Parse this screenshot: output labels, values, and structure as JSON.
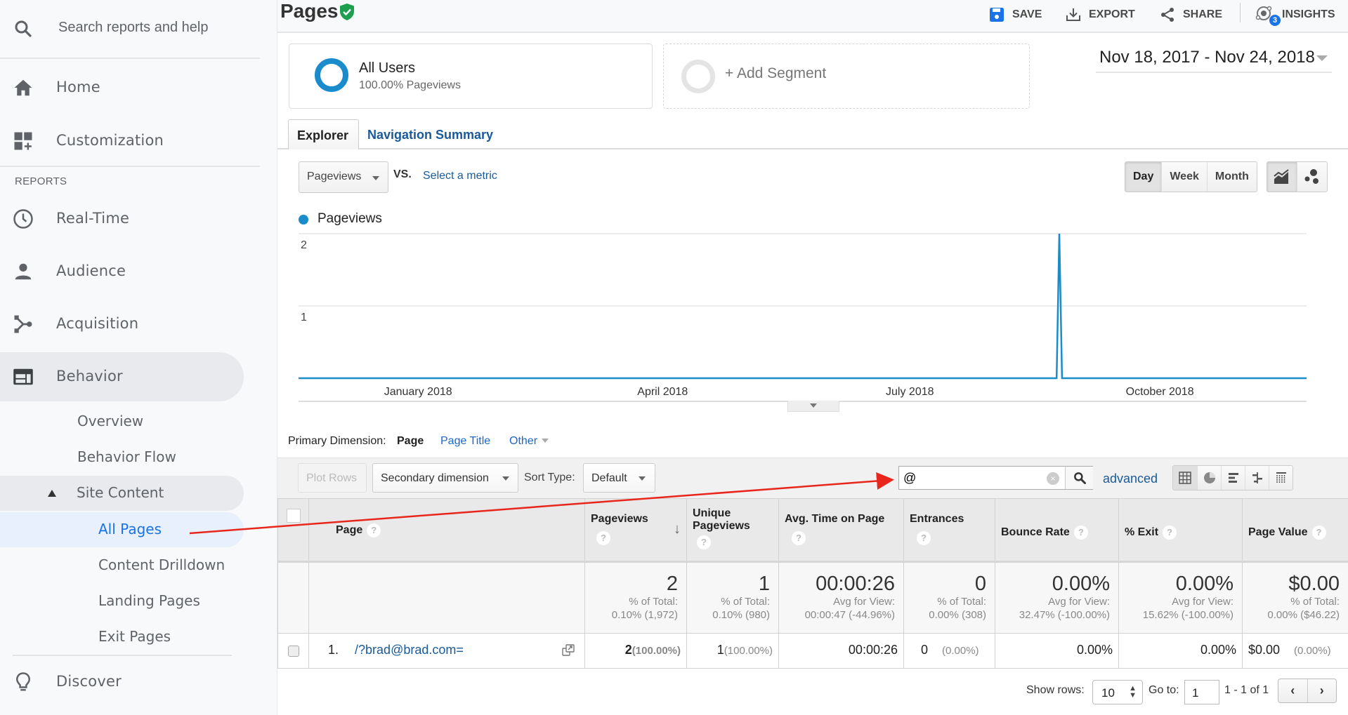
{
  "sidebar": {
    "search_placeholder": "Search reports and help",
    "home": "Home",
    "customization": "Customization",
    "reports_section": "REPORTS",
    "realtime": "Real-Time",
    "audience": "Audience",
    "acquisition": "Acquisition",
    "behavior": "Behavior",
    "behavior_sub": {
      "overview": "Overview",
      "behavior_flow": "Behavior Flow",
      "site_content": "Site Content",
      "all_pages": "All Pages",
      "content_drilldown": "Content Drilldown",
      "landing_pages": "Landing Pages",
      "exit_pages": "Exit Pages"
    },
    "discover": "Discover"
  },
  "header": {
    "title": "Pages",
    "save": "SAVE",
    "export": "EXPORT",
    "share": "SHARE",
    "insights": "INSIGHTS",
    "insights_count": "3"
  },
  "segments": {
    "active_name": "All Users",
    "active_sub": "100.00% Pageviews",
    "add_label": "+ Add Segment"
  },
  "date_range": "Nov 18, 2017 - Nov 24, 2018",
  "tabs": {
    "explorer": "Explorer",
    "navigation_summary": "Navigation Summary"
  },
  "metric_controls": {
    "metric": "Pageviews",
    "vs": "VS.",
    "select_metric": "Select a metric",
    "granularity": [
      "Day",
      "Week",
      "Month"
    ],
    "granularity_selected": "Day"
  },
  "chart_data": {
    "type": "line",
    "legend": [
      "Pageviews"
    ],
    "series_color": "#1a8ccc",
    "x_start": "2017-11-18",
    "x_end": "2018-11-24",
    "xtick_labels": [
      "January 2018",
      "April 2018",
      "July 2018",
      "October 2018"
    ],
    "xtick_dates": [
      "2018-01-01",
      "2018-04-01",
      "2018-07-01",
      "2018-10-01"
    ],
    "ytick_labels": [
      "1",
      "2"
    ],
    "ylim": [
      0,
      2
    ],
    "grid": true,
    "series": [
      {
        "name": "Pageviews",
        "points": [
          {
            "date": "2017-11-18",
            "value": 0
          },
          {
            "date": "2018-08-24",
            "value": 0
          },
          {
            "date": "2018-08-25",
            "value": 2
          },
          {
            "date": "2018-08-26",
            "value": 0
          },
          {
            "date": "2018-11-24",
            "value": 0
          }
        ]
      }
    ]
  },
  "primary_dimension": {
    "label": "Primary Dimension:",
    "options": [
      "Page",
      "Page Title",
      "Other"
    ],
    "selected": "Page"
  },
  "toolbar": {
    "plot_rows": "Plot Rows",
    "secondary_dimension": "Secondary dimension",
    "sort_type_label": "Sort Type:",
    "sort_type_value": "Default",
    "filter_value": "@",
    "advanced": "advanced"
  },
  "table": {
    "columns": [
      {
        "key": "page",
        "label": "Page"
      },
      {
        "key": "pageviews",
        "label": "Pageviews",
        "sorted": "desc"
      },
      {
        "key": "unique_pageviews",
        "label": "Unique Pageviews"
      },
      {
        "key": "avg_time",
        "label": "Avg. Time on Page"
      },
      {
        "key": "entrances",
        "label": "Entrances"
      },
      {
        "key": "bounce_rate",
        "label": "Bounce Rate"
      },
      {
        "key": "exit",
        "label": "% Exit"
      },
      {
        "key": "page_value",
        "label": "Page Value"
      }
    ],
    "totals": {
      "pageviews": {
        "value": "2",
        "l1": "% of Total:",
        "l2": "0.10% (1,972)"
      },
      "unique_pageviews": {
        "value": "1",
        "l1": "% of Total:",
        "l2": "0.10% (980)"
      },
      "avg_time": {
        "value": "00:00:26",
        "l1": "Avg for View:",
        "l2": "00:00:47 (-44.96%)"
      },
      "entrances": {
        "value": "0",
        "l1": "% of Total:",
        "l2": "0.00% (308)"
      },
      "bounce_rate": {
        "value": "0.00%",
        "l1": "Avg for View:",
        "l2": "32.47% (-100.00%)"
      },
      "exit": {
        "value": "0.00%",
        "l1": "Avg for View:",
        "l2": "15.62% (-100.00%)"
      },
      "page_value": {
        "value": "$0.00",
        "l1": "% of Total:",
        "l2": "0.00% ($46.22)"
      }
    },
    "rows": [
      {
        "index": "1.",
        "page": "/?brad@brad.com=",
        "pageviews": "2",
        "pageviews_pct": "(100.00%)",
        "unique_pageviews": "1",
        "unique_pageviews_pct": "(100.00%)",
        "avg_time": "00:00:26",
        "entrances": "0",
        "entrances_pct": "(0.00%)",
        "bounce_rate": "0.00%",
        "exit": "0.00%",
        "page_value": "$0.00",
        "page_value_pct": "(0.00%)"
      }
    ]
  },
  "pager": {
    "show_rows_label": "Show rows:",
    "show_rows_value": "10",
    "goto_label": "Go to:",
    "goto_value": "1",
    "range": "1 - 1 of 1"
  }
}
